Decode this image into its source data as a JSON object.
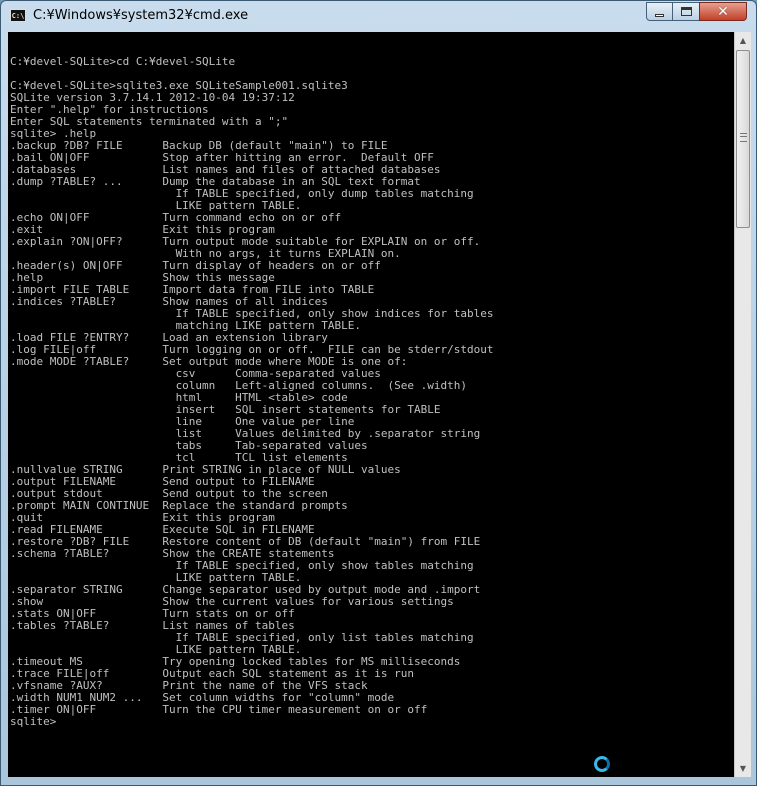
{
  "window": {
    "title": "C:¥Windows¥system32¥cmd.exe",
    "icon_text": "C:\\",
    "controls": [
      "minimize",
      "maximize",
      "close"
    ]
  },
  "console": {
    "lines": [
      "",
      "C:¥devel-SQLite>cd C:¥devel-SQLite",
      "",
      "C:¥devel-SQLite>sqlite3.exe SQLiteSample001.sqlite3",
      "SQLite version 3.7.14.1 2012-10-04 19:37:12",
      "Enter \".help\" for instructions",
      "Enter SQL statements terminated with a \";\"",
      "sqlite> .help",
      ".backup ?DB? FILE      Backup DB (default \"main\") to FILE",
      ".bail ON|OFF           Stop after hitting an error.  Default OFF",
      ".databases             List names and files of attached databases",
      ".dump ?TABLE? ...      Dump the database in an SQL text format",
      "                         If TABLE specified, only dump tables matching",
      "                         LIKE pattern TABLE.",
      ".echo ON|OFF           Turn command echo on or off",
      ".exit                  Exit this program",
      ".explain ?ON|OFF?      Turn output mode suitable for EXPLAIN on or off.",
      "                         With no args, it turns EXPLAIN on.",
      ".header(s) ON|OFF      Turn display of headers on or off",
      ".help                  Show this message",
      ".import FILE TABLE     Import data from FILE into TABLE",
      ".indices ?TABLE?       Show names of all indices",
      "                         If TABLE specified, only show indices for tables",
      "                         matching LIKE pattern TABLE.",
      ".load FILE ?ENTRY?     Load an extension library",
      ".log FILE|off          Turn logging on or off.  FILE can be stderr/stdout",
      ".mode MODE ?TABLE?     Set output mode where MODE is one of:",
      "                         csv      Comma-separated values",
      "                         column   Left-aligned columns.  (See .width)",
      "                         html     HTML <table> code",
      "                         insert   SQL insert statements for TABLE",
      "                         line     One value per line",
      "                         list     Values delimited by .separator string",
      "                         tabs     Tab-separated values",
      "                         tcl      TCL list elements",
      ".nullvalue STRING      Print STRING in place of NULL values",
      ".output FILENAME       Send output to FILENAME",
      ".output stdout         Send output to the screen",
      ".prompt MAIN CONTINUE  Replace the standard prompts",
      ".quit                  Exit this program",
      ".read FILENAME         Execute SQL in FILENAME",
      ".restore ?DB? FILE     Restore content of DB (default \"main\") from FILE",
      ".schema ?TABLE?        Show the CREATE statements",
      "                         If TABLE specified, only show tables matching",
      "                         LIKE pattern TABLE.",
      ".separator STRING      Change separator used by output mode and .import",
      ".show                  Show the current values for various settings",
      ".stats ON|OFF          Turn stats on or off",
      ".tables ?TABLE?        List names of tables",
      "                         If TABLE specified, only list tables matching",
      "                         LIKE pattern TABLE.",
      ".timeout MS            Try opening locked tables for MS milliseconds",
      ".trace FILE|off        Output each SQL statement as it is run",
      ".vfsname ?AUX?         Print the name of the VFS stack",
      ".width NUM1 NUM2 ...   Set column widths for \"column\" mode",
      ".timer ON|OFF          Turn the CPU timer measurement on or off",
      "sqlite>"
    ]
  },
  "scrollbar": {
    "position": 0.1
  },
  "colors": {
    "console_bg": "#000000",
    "console_fg": "#c0c0c0",
    "titlebar": "#b7d0e4",
    "close_button": "#c2402a",
    "busy_indicator": "#3bb8e8"
  },
  "icons": {
    "app": "cmd-app-icon",
    "busy": "busy-spinner-icon"
  }
}
